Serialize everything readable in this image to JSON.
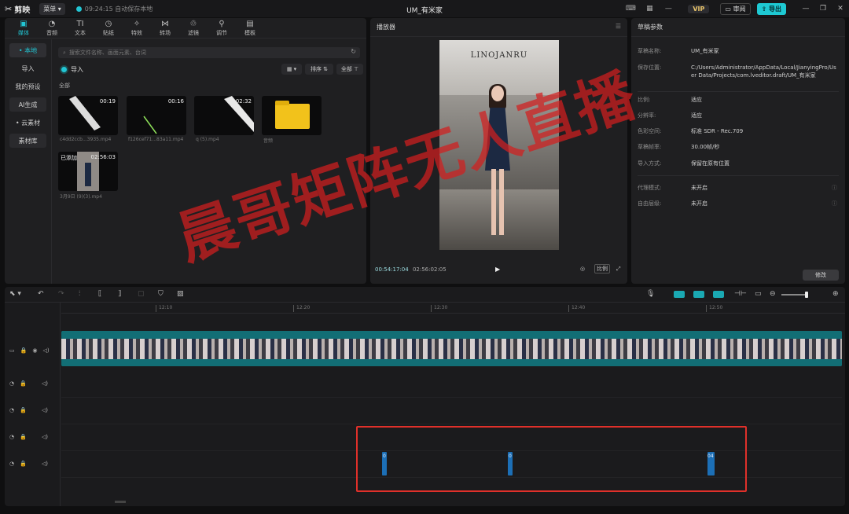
{
  "titlebar": {
    "app_name": "剪映",
    "menu_label": "菜单",
    "autosave_text": "09:24:15 自动保存本地",
    "project_title": "UM_有米家",
    "vip_label": "VIP",
    "review_label": "审阅",
    "export_label": "导出"
  },
  "media": {
    "tabs": [
      {
        "label": "媒体",
        "icon": "media-icon"
      },
      {
        "label": "音频",
        "icon": "audio-icon"
      },
      {
        "label": "文本",
        "icon": "text-icon"
      },
      {
        "label": "贴纸",
        "icon": "sticker-icon"
      },
      {
        "label": "特效",
        "icon": "effect-icon"
      },
      {
        "label": "转场",
        "icon": "transition-icon"
      },
      {
        "label": "滤镜",
        "icon": "filter-icon"
      },
      {
        "label": "调节",
        "icon": "adjust-icon"
      },
      {
        "label": "模板",
        "icon": "template-icon"
      }
    ],
    "sidebar": [
      "• 本地",
      "导入",
      "我的预设",
      "AI生成",
      "• 云素材",
      "素材库"
    ],
    "search_placeholder": "搜索文件名称、画面元素、台词",
    "import_label": "导入",
    "sort_label": "排序",
    "all_label": "全部",
    "group_label": "全部",
    "items": [
      {
        "duration": "00:19",
        "name": "c4dd2ccb...3935.mp4"
      },
      {
        "duration": "00:16",
        "name": "f126cef71...83a11.mp4"
      },
      {
        "duration": "02:32",
        "name": "q (5).mp4"
      },
      {
        "duration": "",
        "name": "音频"
      },
      {
        "duration": "02:56:03",
        "added": "已添加",
        "name": "3月9日 (9)(3).mp4"
      }
    ]
  },
  "player": {
    "header": "播放器",
    "brand": "LINOJANRU",
    "current_time": "00:54:17:04",
    "total_time": "02:56:02:05",
    "ratio_label": "比例"
  },
  "draft": {
    "header": "草稿参数",
    "rows": [
      {
        "label": "草稿名称:",
        "value": "UM_有米家"
      },
      {
        "label": "保存位置:",
        "value": "C:/Users/Administrator/AppData/Local/JianyingPro/User Data/Projects/com.lveditor.draft/UM_有米家"
      },
      {
        "label": "比例:",
        "value": "适应"
      },
      {
        "label": "分辨率:",
        "value": "适应"
      },
      {
        "label": "色彩空间:",
        "value": "标准 SDR - Rec.709"
      },
      {
        "label": "草稿帧率:",
        "value": "30.00帧/秒"
      },
      {
        "label": "导入方式:",
        "value": "保留在原有位置"
      },
      {
        "label": "代理模式:",
        "value": "未开启"
      },
      {
        "label": "自由层级:",
        "value": "未开启"
      }
    ],
    "modify_label": "修改"
  },
  "timeline": {
    "ruler_ticks": [
      "12:10",
      "12:20",
      "12:30",
      "12:40",
      "12:50"
    ],
    "audio_clip_labels": [
      "0",
      "0",
      "04"
    ]
  },
  "watermark": "晨哥矩阵无人直播",
  "colors": {
    "accent": "#22c6d4",
    "highlight_box": "#e0302a",
    "watermark": "#d21e1e"
  }
}
